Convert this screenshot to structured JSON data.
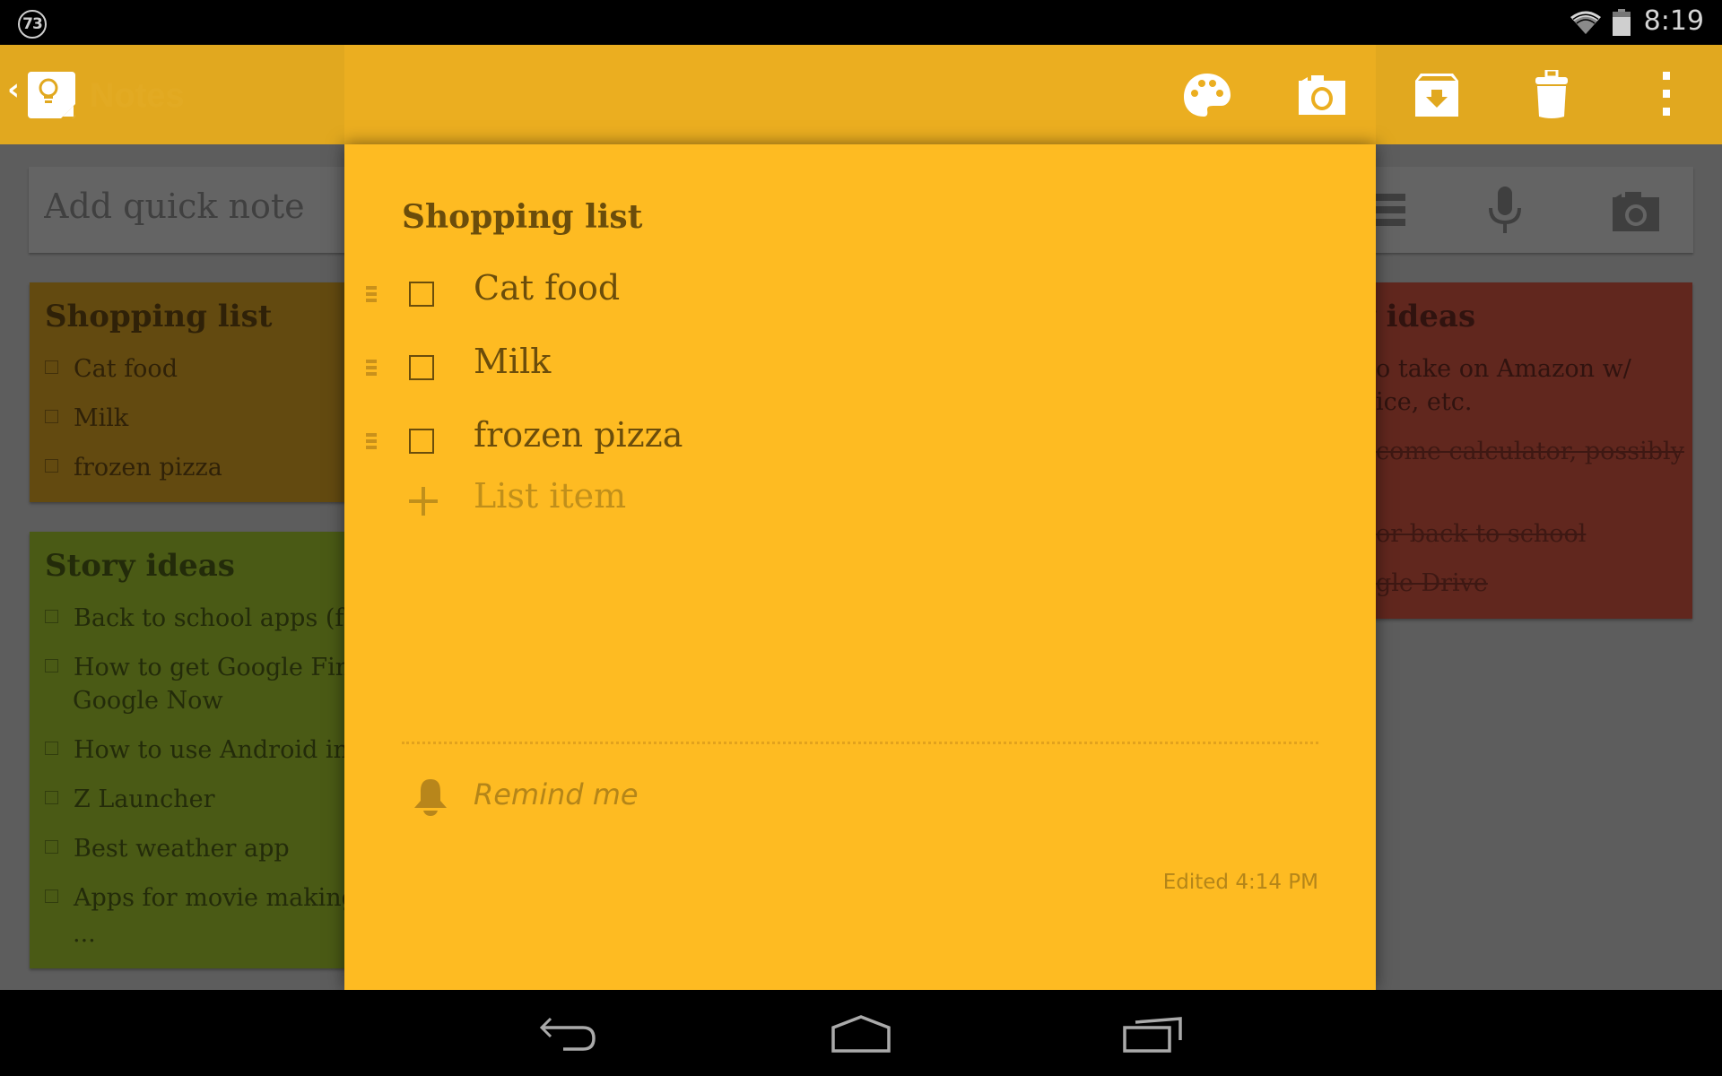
{
  "status_bar": {
    "notification_count": "73",
    "time": "8:19",
    "icons": [
      "notification-badge-icon",
      "wifi-icon",
      "battery-icon"
    ]
  },
  "action_bar": {
    "app_title": "Notes",
    "icons": [
      "back-chevron-icon",
      "keep-logo-icon"
    ]
  },
  "background": {
    "quick_note": {
      "placeholder": "Add quick note",
      "icons": [
        "list-icon",
        "microphone-icon",
        "camera-icon"
      ]
    },
    "cards": [
      {
        "title": "Shopping list",
        "color": "#FFBB22",
        "items": [
          "Cat food",
          "Milk",
          "frozen pizza"
        ]
      },
      {
        "title": "Story ideas",
        "color": "#8BC34A",
        "items": [
          "Back to school apps (fo",
          "How to get Google Fina",
          "Google Now",
          "How to use Android int",
          "Z Launcher",
          "Best weather app",
          "Apps for movie making",
          "..."
        ]
      },
      {
        "title": "y ideas",
        "color": "#E84E3C",
        "items": [
          {
            "text": "o take on Amazon w/",
            "done": false
          },
          {
            "text": "ice, etc.",
            "done": false
          },
          {
            "text": "come calculator, possibly",
            "done": true
          },
          {
            "text": "or back to school",
            "done": true
          },
          {
            "text": "gle Drive",
            "done": true
          }
        ]
      }
    ]
  },
  "note_editor": {
    "color": "#FEBB22",
    "toolbar": [
      "palette-icon",
      "camera-icon",
      "archive-icon",
      "trash-icon",
      "overflow-menu-icon"
    ],
    "title": "Shopping list",
    "items": [
      {
        "text": "Cat food",
        "checked": false
      },
      {
        "text": "Milk",
        "checked": false
      },
      {
        "text": "frozen pizza",
        "checked": false
      }
    ],
    "add_item_placeholder": "List item",
    "remind_label": "Remind me",
    "edited_label": "Edited 4:14 PM"
  },
  "nav_bar": {
    "buttons": [
      "back",
      "home",
      "recents"
    ]
  }
}
